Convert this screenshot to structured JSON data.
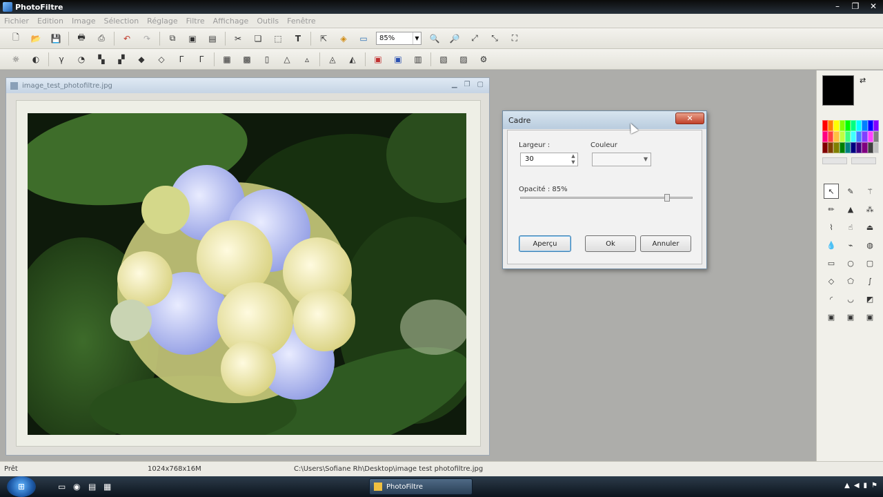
{
  "window": {
    "title": "PhotoFiltre"
  },
  "menu": [
    "Fichier",
    "Edition",
    "Image",
    "Sélection",
    "Réglage",
    "Filtre",
    "Affichage",
    "Outils",
    "Fenêtre"
  ],
  "toolbar1": {
    "icons": [
      "new-icon",
      "open-icon",
      "save-icon",
      "print-icon",
      "scan-icon",
      "undo-icon",
      "redo-icon",
      "copy-icon",
      "paste-icon",
      "paste-new-icon",
      "cut-icon",
      "clone-icon",
      "crop-icon",
      "text-icon",
      "image-size-icon",
      "canvas-size-icon",
      "layer-icon"
    ],
    "zoom_value": "85%",
    "zoom_icons": [
      "zoom-in-icon",
      "zoom-out-icon",
      "fit-icon",
      "actual-size-icon",
      "fullscreen-icon"
    ]
  },
  "toolbar2": {
    "icons": [
      "brightness-icon",
      "contrast-icon",
      "gamma-icon",
      "saturation-icon",
      "levels-icon",
      "filter-icon",
      "sharpen-icon",
      "blur-icon",
      "emboss-icon",
      "edge-icon",
      "grayscale-icon",
      "sepia-icon",
      "negative-icon",
      "mirror-icon",
      "flip-icon",
      "rotate-icon",
      "frame-icon",
      "color-icon",
      "red-eye-icon",
      "transform-icon",
      "resize-icon",
      "pattern-icon"
    ]
  },
  "document": {
    "title": "image_test_photofiltre.jpg"
  },
  "dialog": {
    "title": "Cadre",
    "close_label": "✕",
    "largeur_label": "Largeur :",
    "largeur_value": "30",
    "couleur_label": "Couleur",
    "opacity_label": "Opacité : 85%",
    "opacity_value": 0.85,
    "preview_button": "Aperçu",
    "ok_button": "Ok",
    "cancel_button": "Annuler"
  },
  "palette": {
    "foreground": "#000000",
    "background": "#ffffff",
    "colors": [
      "#ff0000",
      "#ff8000",
      "#ffff00",
      "#80ff00",
      "#00ff00",
      "#00ff80",
      "#00ffff",
      "#0080ff",
      "#0000ff",
      "#8000ff",
      "#ff0080",
      "#ff4040",
      "#ffc040",
      "#c0ff40",
      "#40ff80",
      "#40ffff",
      "#4080ff",
      "#8040ff",
      "#ff40ff",
      "#808080",
      "#800000",
      "#804000",
      "#808000",
      "#008000",
      "#008080",
      "#000080",
      "#400080",
      "#800080",
      "#404040",
      "#c0c0c0"
    ],
    "tools": [
      "select-icon",
      "eyedropper-icon",
      "magic-wand-icon",
      "pencil-icon",
      "fill-icon",
      "spray-icon",
      "brush-icon",
      "smudge-icon",
      "stamp-icon",
      "drop-icon",
      "wand-icon",
      "blur-tool-icon",
      "rect-icon",
      "ellipse-icon",
      "rounded-rect-icon",
      "lasso-icon",
      "polygon-icon",
      "curve-icon",
      "shape-a-icon",
      "shape-b-icon",
      "shape-c-icon",
      "mirror-h-icon",
      "mirror-v-icon",
      "mirror-c-icon"
    ]
  },
  "status": {
    "left": "Prêt",
    "dimensions": "1024x768x16M",
    "path": "C:\\Users\\Sofiane Rh\\Desktop\\image test photofiltre.jpg"
  },
  "taskbar": {
    "task_label": "PhotoFiltre"
  }
}
